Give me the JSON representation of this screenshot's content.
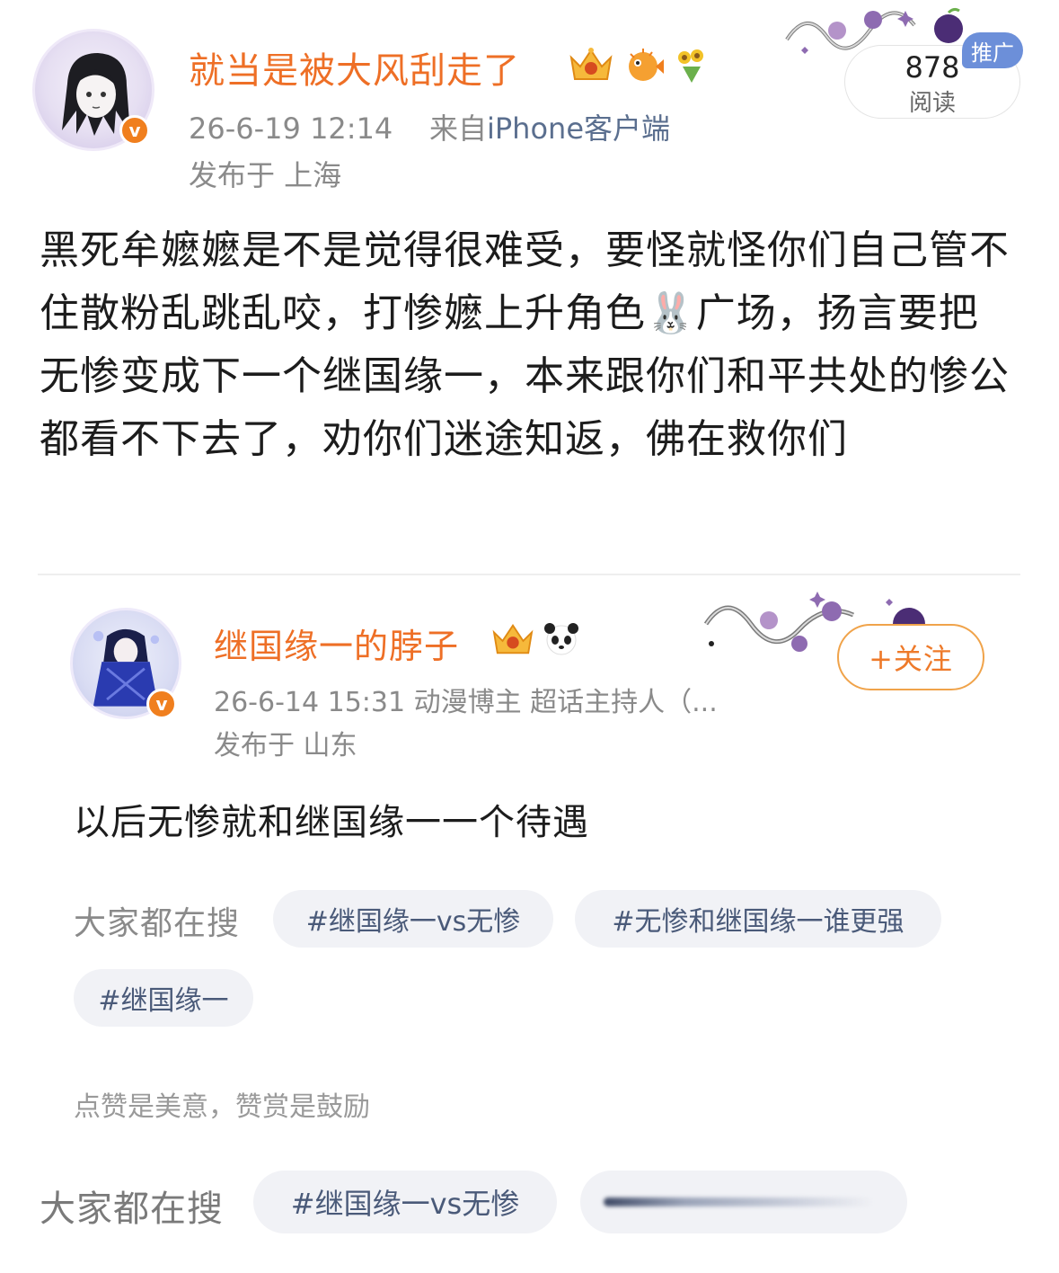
{
  "post": {
    "username": "就当是被大风刮走了",
    "time": "26-6-19 12:14",
    "source_prefix": "来自",
    "source": "iPhone客户端",
    "location": "发布于 上海",
    "read_count": "878",
    "read_label": "阅读",
    "promo_badge": "推广",
    "body": "黑死牟嬷嬷是不是觉得很难受，要怪就怪你们自己管不住散粉乱跳乱咬，打惨嬷上升角色🐰广场，扬言要把无惨变成下一个继国缘一，本来跟你们和平共处的惨公都看不下去了，劝你们迷途知返，佛在救你们"
  },
  "repost": {
    "username": "继国缘一的脖子",
    "meta": "26-6-14 15:31  动漫博主 超话主持人（...",
    "location": "发布于 山东",
    "follow_label": "+关注",
    "body": "以后无惨就和继国缘一一个待遇",
    "search_label": "大家都在搜",
    "tags": [
      "#继国缘一vs无惨",
      "#无惨和继国缘一谁更强",
      "#继国缘一"
    ],
    "reward_text": "点赞是美意，赞赏是鼓励"
  },
  "bottom": {
    "search_label": "大家都在搜",
    "tags": [
      "#继国缘一vs无惨"
    ]
  },
  "icons": {
    "verified": "v",
    "colors": {
      "accent_orange": "#ee6f26",
      "link_blue": "#5b6f8f",
      "promo_blue": "#6c8fd9"
    }
  }
}
